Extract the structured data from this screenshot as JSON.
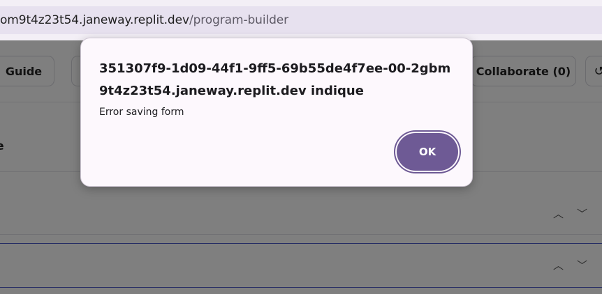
{
  "browser": {
    "url_host": "om9t4z23t54.janeway.replit.dev",
    "url_path": "/program-builder"
  },
  "toolbar": {
    "guide_label": "Guide",
    "collaborate_label": "Collaborate (0)",
    "history_icon": "history-icon"
  },
  "form": {
    "name_label": "ne"
  },
  "dialog": {
    "title": "351307f9-1d09-44f1-9ff5-69b55de4f7ee-00-2gbm9t4z23t54.janeway.replit.dev indique",
    "message": "Error saving form",
    "ok_label": "OK"
  },
  "icons": {
    "chevron_up": "^",
    "chevron_down": "v"
  },
  "colors": {
    "ok_button": "#6e5a95",
    "dialog_bg": "#fdf8fd",
    "section_highlight": "#4a58c8"
  }
}
